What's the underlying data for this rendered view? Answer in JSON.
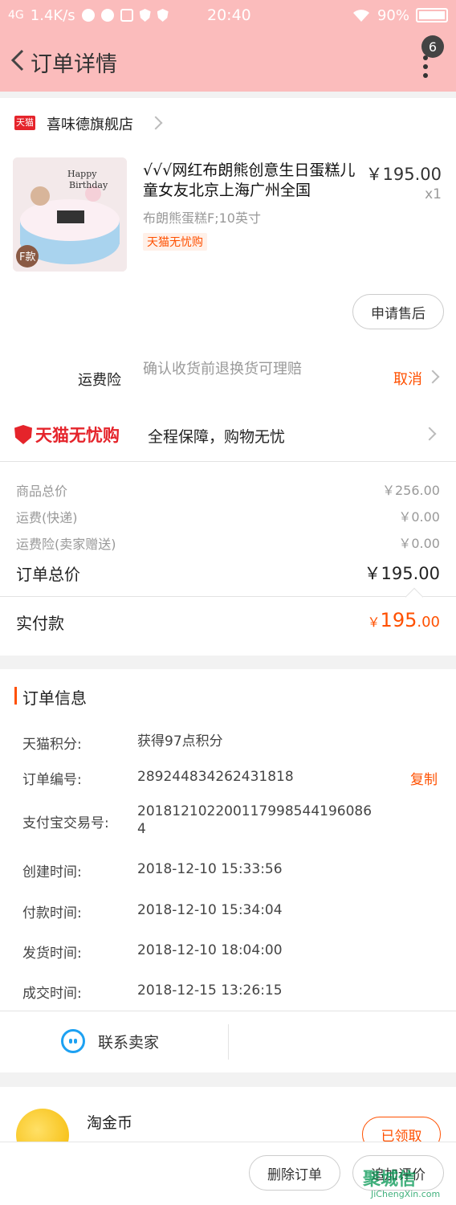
{
  "status_bar": {
    "network": "4G",
    "speed": "1.4K/s",
    "time": "20:40",
    "battery": "90%"
  },
  "nav": {
    "title": "订单详情",
    "badge_count": "6"
  },
  "shop": {
    "logo_text": "天猫",
    "name": "喜味德旗舰店"
  },
  "product": {
    "title": "√√√网红布朗熊创意生日蛋糕儿童女友北京上海广州全国",
    "price": "￥195.00",
    "quantity": "x1",
    "sku": "布朗熊蛋糕F;10英寸",
    "tag": "天猫无忧购",
    "image_label": "F款",
    "after_sale_label": "申请售后"
  },
  "insurance": {
    "label": "运费险",
    "desc": "确认收货前退换货可理赔",
    "action": "取消"
  },
  "tmall_guarantee": {
    "logo": "天猫无忧购",
    "desc": "全程保障，购物无忧"
  },
  "summary": {
    "items": [
      {
        "label": "商品总价",
        "value": "￥256.00"
      },
      {
        "label": "运费(快递)",
        "value": "￥0.00"
      },
      {
        "label": "运费险(卖家赠送)",
        "value": "￥0.00"
      }
    ],
    "total_label": "订单总价",
    "total_value": "￥195.00",
    "paid_label": "实付款",
    "paid_currency": "￥",
    "paid_int": "195",
    "paid_dec": ".00"
  },
  "order_info": {
    "title": "订单信息",
    "rows": [
      {
        "label": "天猫积分:",
        "value": "获得97点积分"
      },
      {
        "label": "订单编号:",
        "value": "289244834262431818"
      },
      {
        "label": "支付宝交易号:",
        "value": "2018121022001179985441960864"
      },
      {
        "label": "创建时间:",
        "value": "2018-12-10 15:33:56"
      },
      {
        "label": "付款时间:",
        "value": "2018-12-10 15:34:04"
      },
      {
        "label": "发货时间:",
        "value": "2018-12-10 18:04:00"
      },
      {
        "label": "成交时间:",
        "value": "2018-12-15 13:26:15"
      }
    ],
    "copy_label": "复制"
  },
  "contact": {
    "label": "联系卖家"
  },
  "coins": {
    "label": "淘金币",
    "action": "已领取"
  },
  "bottom": {
    "delete_label": "删除订单",
    "review_label": "追加评价"
  },
  "watermark": {
    "text": "聚城信",
    "sub": "JiChengXin.com"
  }
}
